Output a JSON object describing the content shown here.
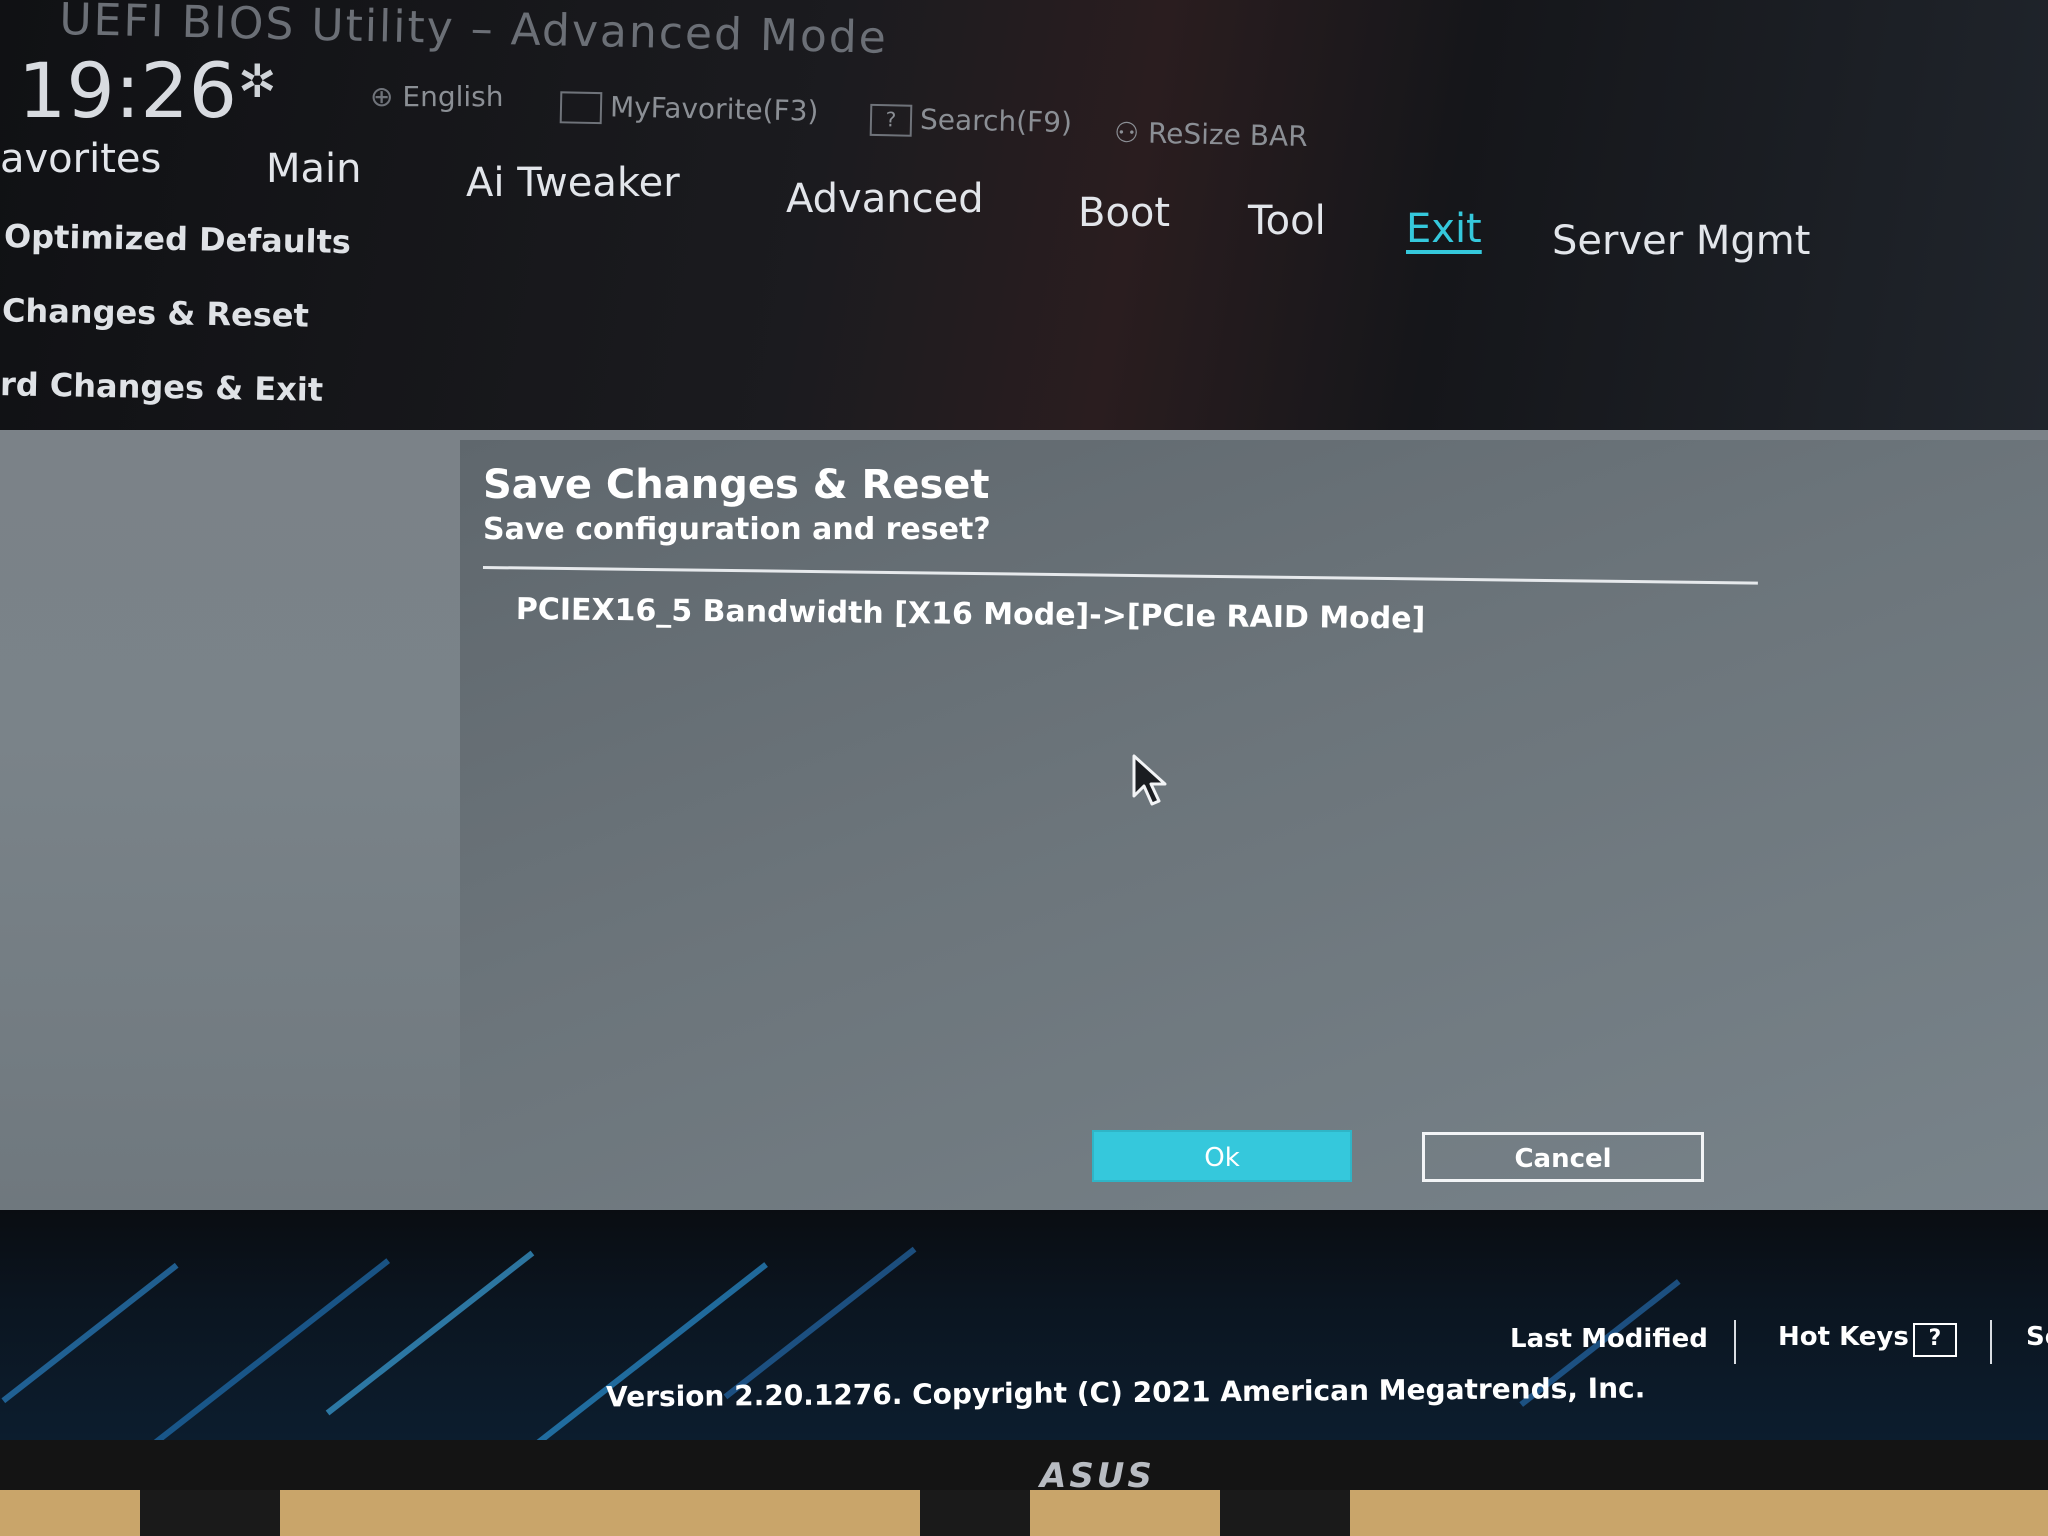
{
  "window": {
    "title": "UEFI BIOS Utility – Advanced Mode",
    "clock": "19:26"
  },
  "toolbar": {
    "language": "English",
    "myfavorite": "MyFavorite(F3)",
    "search": "Search(F9)",
    "resize_bar": "ReSize BAR"
  },
  "tabs": [
    {
      "label": "avorites"
    },
    {
      "label": "Main"
    },
    {
      "label": "Ai Tweaker"
    },
    {
      "label": "Advanced"
    },
    {
      "label": "Boot"
    },
    {
      "label": "Tool"
    },
    {
      "label": "Exit",
      "active": true
    },
    {
      "label": "Server Mgmt"
    }
  ],
  "exit_menu": [
    {
      "label": "Optimized Defaults"
    },
    {
      "label": "Changes & Reset"
    },
    {
      "label": "rd Changes & Exit"
    }
  ],
  "dialog": {
    "title": "Save Changes & Reset",
    "subtitle": "Save configuration and reset?",
    "change": "PCIEX16_5 Bandwidth [X16 Mode]->[PCIe RAID Mode]",
    "ok_label": "Ok",
    "cancel_label": "Cancel"
  },
  "footer": {
    "last_modified": "Last Modified",
    "hot_keys": "Hot Keys",
    "hot_keys_key": "?",
    "truncated": "Se",
    "version": "Version 2.20.1276. Copyright (C) 2021 American Megatrends, Inc."
  },
  "monitor": {
    "brand": "ASUS"
  },
  "colors": {
    "accent": "#35c8dc",
    "dialog_bg": "#6c757b",
    "header_bg": "#17181c"
  }
}
